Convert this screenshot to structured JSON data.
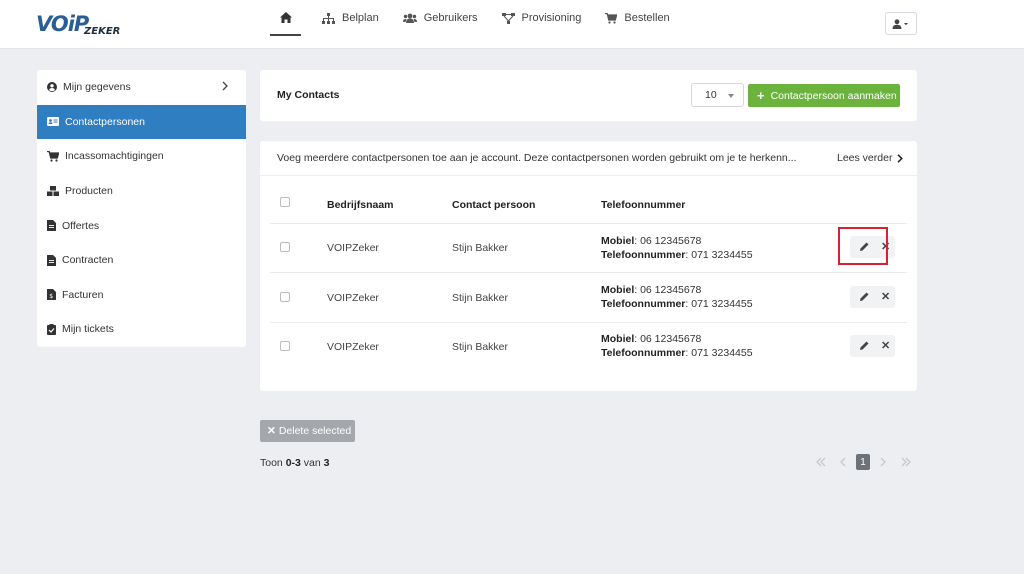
{
  "brand": {
    "logo_main": "VOiP",
    "logo_sub": "ZEKER"
  },
  "nav": {
    "items": [
      {
        "label": "Belplan",
        "icon": "sitemap-icon"
      },
      {
        "label": "Gebruikers",
        "icon": "users-icon"
      },
      {
        "label": "Provisioning",
        "icon": "network-icon"
      },
      {
        "label": "Bestellen",
        "icon": "cart-icon"
      }
    ],
    "home_icon": "home-icon",
    "user_icon": "user-icon"
  },
  "sidebar": {
    "items": [
      {
        "label": "Mijn gegevens",
        "icon": "user-circle-icon"
      },
      {
        "label": "Contactpersonen",
        "icon": "id-card-icon",
        "active": true
      },
      {
        "label": "Incassomachtigingen",
        "icon": "cart-icon"
      },
      {
        "label": "Producten",
        "icon": "boxes-icon"
      },
      {
        "label": "Offertes",
        "icon": "file-icon"
      },
      {
        "label": "Contracten",
        "icon": "file-icon"
      },
      {
        "label": "Facturen",
        "icon": "invoice-icon"
      },
      {
        "label": "Mijn tickets",
        "icon": "ticket-icon"
      }
    ],
    "active_color": "#2e7ec1"
  },
  "contacts_card": {
    "title": "My Contacts",
    "per_page": "10",
    "create_label": "Contactpersoon aanmaken",
    "create_color": "#6cb33e"
  },
  "table": {
    "intro": "Voeg meerdere contactpersonen toe aan je account. Deze contactpersonen worden gebruikt om je te herkenn...",
    "read_more": "Lees verder",
    "headers": {
      "company": "Bedrijfsnaam",
      "contact": "Contact persoon",
      "phone": "Telefoonnummer"
    },
    "mobile_label": "Mobiel",
    "phone_label": "Telefoonnummer",
    "rows": [
      {
        "company": "VOIPZeker",
        "contact": "Stijn Bakker",
        "mobile": ": 06 12345678",
        "phone": ": 071 3234455"
      },
      {
        "company": "VOIPZeker",
        "contact": "Stijn Bakker",
        "mobile": ": 06 12345678",
        "phone": ": 071 3234455"
      },
      {
        "company": "VOIPZeker",
        "contact": "Stijn Bakker",
        "mobile": ": 06 12345678",
        "phone": ": 071 3234455"
      }
    ],
    "delete_symbol": "✕"
  },
  "footer": {
    "delete_label": "Delete selected",
    "showing_prefix": "Toon ",
    "showing_range": "0-3",
    "showing_mid": " van ",
    "showing_total": "3",
    "current_page": "1"
  }
}
